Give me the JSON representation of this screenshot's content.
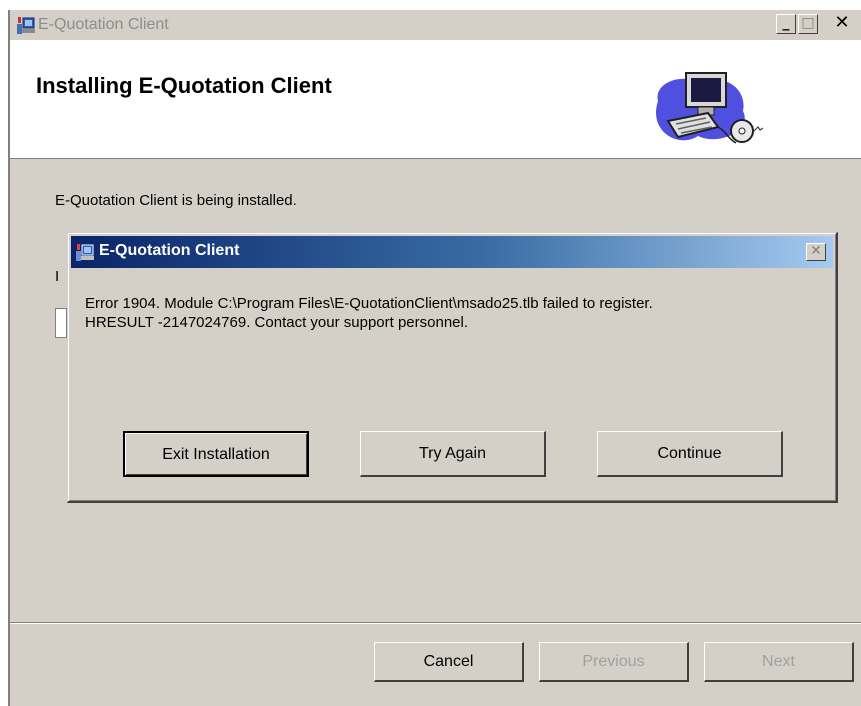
{
  "window": {
    "title": "E-Quotation Client",
    "controls": {
      "minimize": "_",
      "maximize": "□",
      "close": "✕"
    }
  },
  "header": {
    "title": "Installing E-Quotation Client",
    "graphic": "computer-setup-icon"
  },
  "body": {
    "status": "E-Quotation Client is being installed.",
    "obscured_label_fragment": "I"
  },
  "footer": {
    "cancel_label": "Cancel",
    "previous_label": "Previous",
    "next_label": "Next"
  },
  "dialog": {
    "title": "E-Quotation Client",
    "close": "✕",
    "message_line1": "Error 1904. Module C:\\Program Files\\E-QuotationClient\\msado25.tlb failed to register.",
    "message_line2": "HRESULT -2147024769.  Contact your support personnel.",
    "buttons": {
      "exit": "Exit Installation",
      "retry": "Try Again",
      "continue": "Continue"
    }
  },
  "colors": {
    "face": "#d4d0c8",
    "dialog_title_start": "#0a246a",
    "dialog_title_end": "#a6caf0"
  }
}
